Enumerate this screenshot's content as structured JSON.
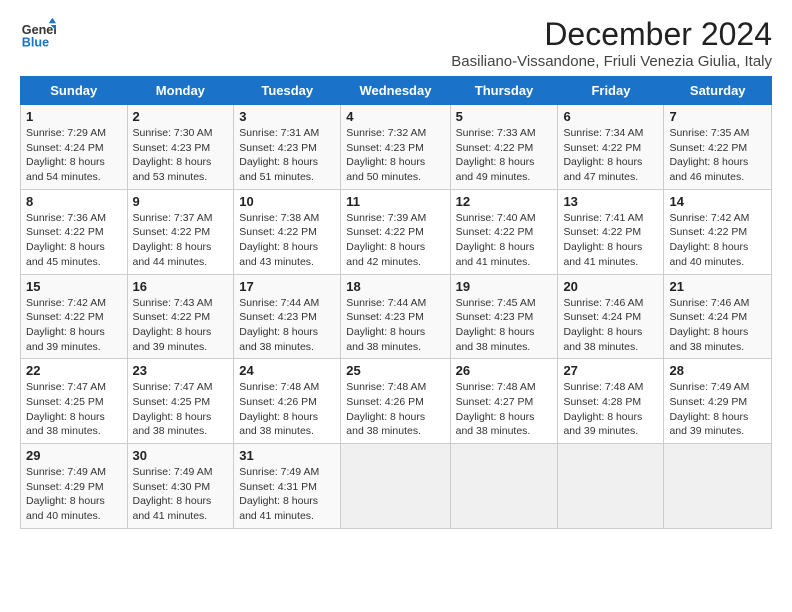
{
  "header": {
    "logo_line1": "General",
    "logo_line2": "Blue",
    "title": "December 2024",
    "subtitle": "Basiliano-Vissandone, Friuli Venezia Giulia, Italy"
  },
  "days_of_week": [
    "Sunday",
    "Monday",
    "Tuesday",
    "Wednesday",
    "Thursday",
    "Friday",
    "Saturday"
  ],
  "weeks": [
    [
      {
        "day": 1,
        "sunrise": "7:29 AM",
        "sunset": "4:24 PM",
        "daylight": "8 hours and 54 minutes."
      },
      {
        "day": 2,
        "sunrise": "7:30 AM",
        "sunset": "4:23 PM",
        "daylight": "8 hours and 53 minutes."
      },
      {
        "day": 3,
        "sunrise": "7:31 AM",
        "sunset": "4:23 PM",
        "daylight": "8 hours and 51 minutes."
      },
      {
        "day": 4,
        "sunrise": "7:32 AM",
        "sunset": "4:23 PM",
        "daylight": "8 hours and 50 minutes."
      },
      {
        "day": 5,
        "sunrise": "7:33 AM",
        "sunset": "4:22 PM",
        "daylight": "8 hours and 49 minutes."
      },
      {
        "day": 6,
        "sunrise": "7:34 AM",
        "sunset": "4:22 PM",
        "daylight": "8 hours and 47 minutes."
      },
      {
        "day": 7,
        "sunrise": "7:35 AM",
        "sunset": "4:22 PM",
        "daylight": "8 hours and 46 minutes."
      }
    ],
    [
      {
        "day": 8,
        "sunrise": "7:36 AM",
        "sunset": "4:22 PM",
        "daylight": "8 hours and 45 minutes."
      },
      {
        "day": 9,
        "sunrise": "7:37 AM",
        "sunset": "4:22 PM",
        "daylight": "8 hours and 44 minutes."
      },
      {
        "day": 10,
        "sunrise": "7:38 AM",
        "sunset": "4:22 PM",
        "daylight": "8 hours and 43 minutes."
      },
      {
        "day": 11,
        "sunrise": "7:39 AM",
        "sunset": "4:22 PM",
        "daylight": "8 hours and 42 minutes."
      },
      {
        "day": 12,
        "sunrise": "7:40 AM",
        "sunset": "4:22 PM",
        "daylight": "8 hours and 41 minutes."
      },
      {
        "day": 13,
        "sunrise": "7:41 AM",
        "sunset": "4:22 PM",
        "daylight": "8 hours and 41 minutes."
      },
      {
        "day": 14,
        "sunrise": "7:42 AM",
        "sunset": "4:22 PM",
        "daylight": "8 hours and 40 minutes."
      }
    ],
    [
      {
        "day": 15,
        "sunrise": "7:42 AM",
        "sunset": "4:22 PM",
        "daylight": "8 hours and 39 minutes."
      },
      {
        "day": 16,
        "sunrise": "7:43 AM",
        "sunset": "4:22 PM",
        "daylight": "8 hours and 39 minutes."
      },
      {
        "day": 17,
        "sunrise": "7:44 AM",
        "sunset": "4:23 PM",
        "daylight": "8 hours and 38 minutes."
      },
      {
        "day": 18,
        "sunrise": "7:44 AM",
        "sunset": "4:23 PM",
        "daylight": "8 hours and 38 minutes."
      },
      {
        "day": 19,
        "sunrise": "7:45 AM",
        "sunset": "4:23 PM",
        "daylight": "8 hours and 38 minutes."
      },
      {
        "day": 20,
        "sunrise": "7:46 AM",
        "sunset": "4:24 PM",
        "daylight": "8 hours and 38 minutes."
      },
      {
        "day": 21,
        "sunrise": "7:46 AM",
        "sunset": "4:24 PM",
        "daylight": "8 hours and 38 minutes."
      }
    ],
    [
      {
        "day": 22,
        "sunrise": "7:47 AM",
        "sunset": "4:25 PM",
        "daylight": "8 hours and 38 minutes."
      },
      {
        "day": 23,
        "sunrise": "7:47 AM",
        "sunset": "4:25 PM",
        "daylight": "8 hours and 38 minutes."
      },
      {
        "day": 24,
        "sunrise": "7:48 AM",
        "sunset": "4:26 PM",
        "daylight": "8 hours and 38 minutes."
      },
      {
        "day": 25,
        "sunrise": "7:48 AM",
        "sunset": "4:26 PM",
        "daylight": "8 hours and 38 minutes."
      },
      {
        "day": 26,
        "sunrise": "7:48 AM",
        "sunset": "4:27 PM",
        "daylight": "8 hours and 38 minutes."
      },
      {
        "day": 27,
        "sunrise": "7:48 AM",
        "sunset": "4:28 PM",
        "daylight": "8 hours and 39 minutes."
      },
      {
        "day": 28,
        "sunrise": "7:49 AM",
        "sunset": "4:29 PM",
        "daylight": "8 hours and 39 minutes."
      }
    ],
    [
      {
        "day": 29,
        "sunrise": "7:49 AM",
        "sunset": "4:29 PM",
        "daylight": "8 hours and 40 minutes."
      },
      {
        "day": 30,
        "sunrise": "7:49 AM",
        "sunset": "4:30 PM",
        "daylight": "8 hours and 41 minutes."
      },
      {
        "day": 31,
        "sunrise": "7:49 AM",
        "sunset": "4:31 PM",
        "daylight": "8 hours and 41 minutes."
      },
      null,
      null,
      null,
      null
    ]
  ]
}
